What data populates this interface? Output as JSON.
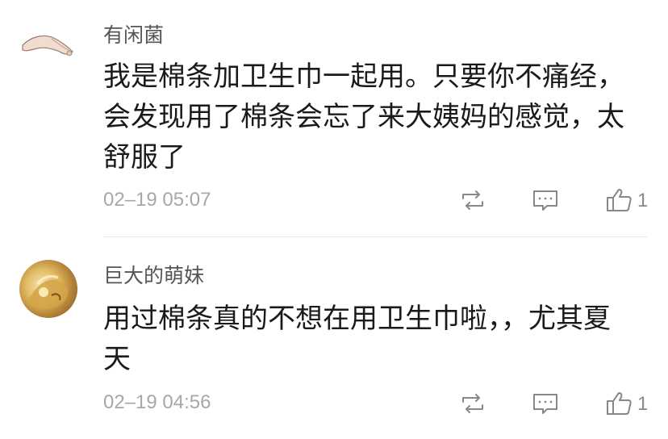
{
  "comments": [
    {
      "username": "有闲菌",
      "text_lines": [
        "我是棉条加卫生巾一起用。只要你不痛经，",
        "会发现用了棉条会忘了来大姨妈的感觉，太",
        "舒服了"
      ],
      "time": "02–19 05:07",
      "likes": "1",
      "avatar_icon": "hand-avatar-icon"
    },
    {
      "username": "巨大的萌妹",
      "text_lines": [
        "用过棉条真的不想在用卫生巾啦，，尤其夏",
        "天"
      ],
      "time": "02–19 04:56",
      "likes": "1",
      "avatar_icon": "golden-figure-avatar-icon"
    }
  ],
  "colors": {
    "username": "#555555",
    "body": "#1a1a1a",
    "meta": "#a7a7a7",
    "icon": "#888888",
    "divider": "#e6e6e6"
  }
}
